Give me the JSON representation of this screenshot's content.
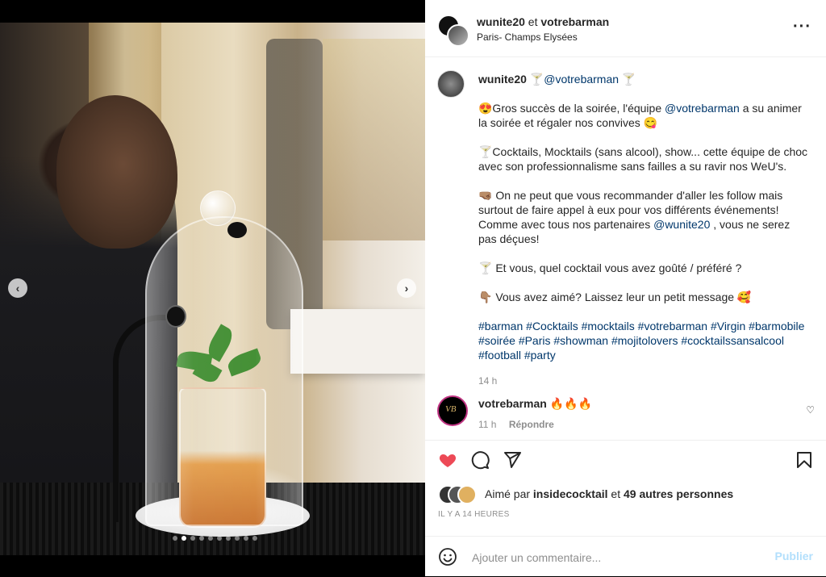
{
  "post": {
    "header": {
      "author": "wunite20",
      "connector": "et",
      "collaborator": "votrebarman",
      "location": "Paris- Champs Elysées",
      "more_icon": "more-horizontal-icon"
    },
    "caption": {
      "username": "wunite20",
      "intro_tag": "🍸@votrebarman 🍸",
      "p1_a": "😍Gros succès de la soirée, l'équipe ",
      "p1_mention": "@votrebarman",
      "p1_b": " a su animer la soirée et régaler nos convives 😋",
      "p2": "🍸Cocktails, Mocktails (sans alcool), show... cette équipe de choc avec son professionnalisme sans failles a su ravir nos WeU's.",
      "p3_a": "🤜🏽 On ne peut que vous recommander d'aller les follow mais surtout de faire appel à eux pour vos différents événements! Comme avec tous nos partenaires ",
      "p3_mention": "@wunite20",
      "p3_b": " , vous ne serez pas déçues!",
      "p4": "🍸 Et vous, quel cocktail vous avez goûté / préféré ?",
      "p5": "👇🏽 Vous avez aimé? Laissez leur un petit message 🥰",
      "hashtags": [
        "#barman",
        "#Cocktails",
        "#mocktails",
        "#votrebarman",
        "#Virgin",
        "#barmobile",
        "#soirée",
        "#Paris",
        "#showman",
        "#mojitolovers",
        "#cocktailssansalcool",
        "#football",
        "#party"
      ],
      "time": "14 h"
    },
    "comment": {
      "avatar_text": "VB",
      "username": "votrebarman",
      "text": "🔥🔥🔥",
      "time": "11 h",
      "reply_label": "Répondre",
      "like_icon": "heart-outline-icon"
    },
    "actions": {
      "like_icon": "heart-filled-icon",
      "comment_icon": "comment-icon",
      "share_icon": "paper-plane-icon",
      "save_icon": "bookmark-icon",
      "like_color": "#ed4956"
    },
    "likes": {
      "prefix": "Aimé par",
      "liker": "insidecocktail",
      "middle": "et",
      "others": "49 autres personnes"
    },
    "date": "IL Y A 14 HEURES",
    "add_comment": {
      "placeholder": "Ajouter un commentaire...",
      "publish_label": "Publier",
      "emoji_icon": "smiley-icon"
    }
  },
  "media": {
    "carousel": {
      "count": 10,
      "active_index": 1
    },
    "prev_icon": "chevron-left-icon",
    "next_icon": "chevron-right-icon"
  }
}
